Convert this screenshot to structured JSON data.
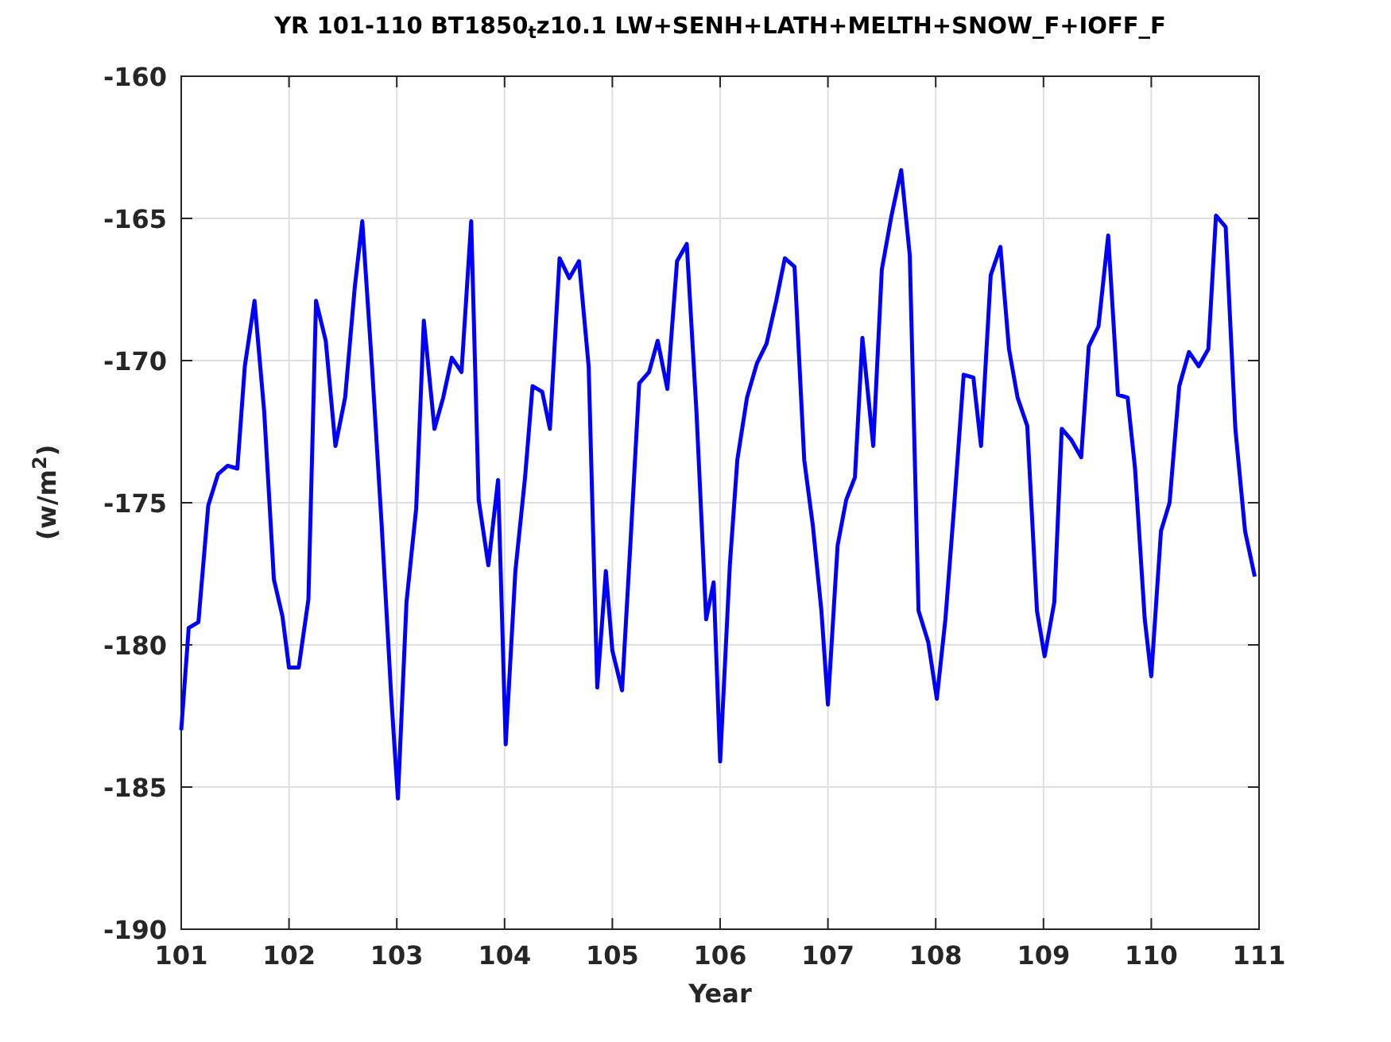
{
  "figure": {
    "chart_data": {
      "type": "line",
      "title": "YR 101-110 BT1850$_{t}$z10.1 LW+SENH+LATH+MELTH+SNOW_F+IOFF_F",
      "xlabel": "Year",
      "ylabel": "(w/m$^{2}$)",
      "x": [
        101.0,
        101.07,
        101.16,
        101.25,
        101.34,
        101.43,
        101.52,
        101.59,
        101.68,
        101.77,
        101.86,
        101.94,
        102.0,
        102.09,
        102.18,
        102.25,
        102.34,
        102.43,
        102.52,
        102.61,
        102.68,
        102.77,
        102.86,
        102.95,
        103.01,
        103.09,
        103.18,
        103.25,
        103.35,
        103.43,
        103.51,
        103.6,
        103.69,
        103.76,
        103.85,
        103.94,
        104.01,
        104.1,
        104.19,
        104.26,
        104.35,
        104.42,
        104.51,
        104.6,
        104.69,
        104.78,
        104.86,
        104.94,
        105.0,
        105.09,
        105.17,
        105.25,
        105.34,
        105.42,
        105.51,
        105.6,
        105.69,
        105.78,
        105.87,
        105.94,
        106.0,
        106.09,
        106.16,
        106.25,
        106.34,
        106.43,
        106.52,
        106.6,
        106.69,
        106.78,
        106.86,
        106.94,
        107.0,
        107.09,
        107.17,
        107.25,
        107.32,
        107.42,
        107.5,
        107.59,
        107.68,
        107.76,
        107.84,
        107.93,
        108.01,
        108.09,
        108.17,
        108.26,
        108.35,
        108.42,
        108.51,
        108.6,
        108.68,
        108.76,
        108.85,
        108.94,
        109.01,
        109.1,
        109.17,
        109.26,
        109.35,
        109.42,
        109.51,
        109.6,
        109.69,
        109.78,
        109.85,
        109.94,
        110.0,
        110.09,
        110.17,
        110.26,
        110.35,
        110.44,
        110.53,
        110.6,
        110.69,
        110.78,
        110.87,
        110.96
      ],
      "series": [
        {
          "color": "#0000ff",
          "values": [
            -183.0,
            -179.4,
            -179.2,
            -175.1,
            -174.0,
            -173.7,
            -173.8,
            -170.2,
            -167.9,
            -171.8,
            -177.7,
            -179.0,
            -180.8,
            -180.8,
            -178.4,
            -167.9,
            -169.3,
            -173.0,
            -171.3,
            -167.4,
            -165.1,
            -170.2,
            -175.8,
            -181.9,
            -185.4,
            -178.5,
            -175.2,
            -168.6,
            -172.4,
            -171.3,
            -169.9,
            -170.4,
            -165.1,
            -174.9,
            -177.2,
            -174.2,
            -183.5,
            -177.4,
            -174.1,
            -170.9,
            -171.1,
            -172.4,
            -166.4,
            -167.1,
            -166.5,
            -170.2,
            -181.5,
            -177.4,
            -180.2,
            -181.6,
            -176.3,
            -170.8,
            -170.4,
            -169.3,
            -171.0,
            -166.5,
            -165.9,
            -171.8,
            -179.1,
            -177.8,
            -184.1,
            -177.2,
            -173.5,
            -171.3,
            -170.1,
            -169.4,
            -167.9,
            -166.4,
            -166.7,
            -173.5,
            -175.8,
            -178.8,
            -182.1,
            -176.5,
            -174.9,
            -174.1,
            -169.2,
            -173.0,
            -166.8,
            -164.9,
            -163.3,
            -166.3,
            -178.8,
            -179.9,
            -181.9,
            -179.1,
            -175.2,
            -170.5,
            -170.6,
            -173.0,
            -167.0,
            -166.0,
            -169.6,
            -171.3,
            -172.3,
            -178.8,
            -180.4,
            -178.5,
            -172.4,
            -172.8,
            -173.4,
            -169.5,
            -168.8,
            -165.6,
            -171.2,
            -171.3,
            -173.8,
            -179.1,
            -181.1,
            -176.0,
            -175.0,
            -170.9,
            -169.7,
            -170.2,
            -169.6,
            -164.9,
            -165.3,
            -172.4,
            -176.0,
            -177.6
          ]
        }
      ],
      "grid": true,
      "xlim": [
        101,
        111
      ],
      "ylim": [
        -190,
        -160
      ],
      "xticks": [
        101,
        102,
        103,
        104,
        105,
        106,
        107,
        108,
        109,
        110,
        111
      ],
      "yticks": [
        -190,
        -185,
        -180,
        -175,
        -170,
        -165,
        -160
      ]
    }
  }
}
